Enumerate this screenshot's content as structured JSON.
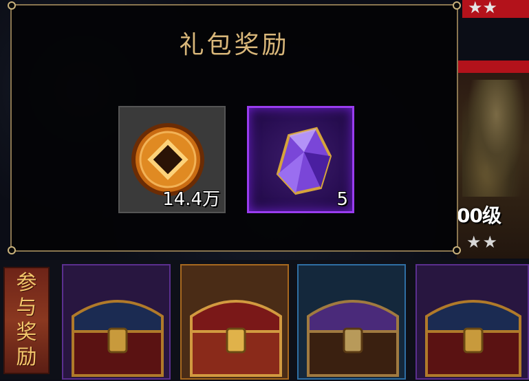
{
  "modal": {
    "title": "礼包奖励",
    "rewards": [
      {
        "icon": "copper-coin-icon",
        "amount": "14.4万"
      },
      {
        "icon": "purple-gem-icon",
        "amount": "5"
      }
    ]
  },
  "background": {
    "hero_level": "00级",
    "join_rewards_label": "参与奖励",
    "chests": [
      {
        "icon": "treasure-chest-icon",
        "rarity": "purple"
      },
      {
        "icon": "treasure-chest-icon",
        "rarity": "orange"
      },
      {
        "icon": "treasure-chest-icon",
        "rarity": "blue"
      },
      {
        "icon": "treasure-chest-icon",
        "rarity": "purple"
      }
    ]
  },
  "colors": {
    "title_gold": "#d9b77a",
    "modal_border": "#8a7650",
    "gem_frame_purple": "#9a3cf0",
    "card_red": "#b3121b"
  }
}
